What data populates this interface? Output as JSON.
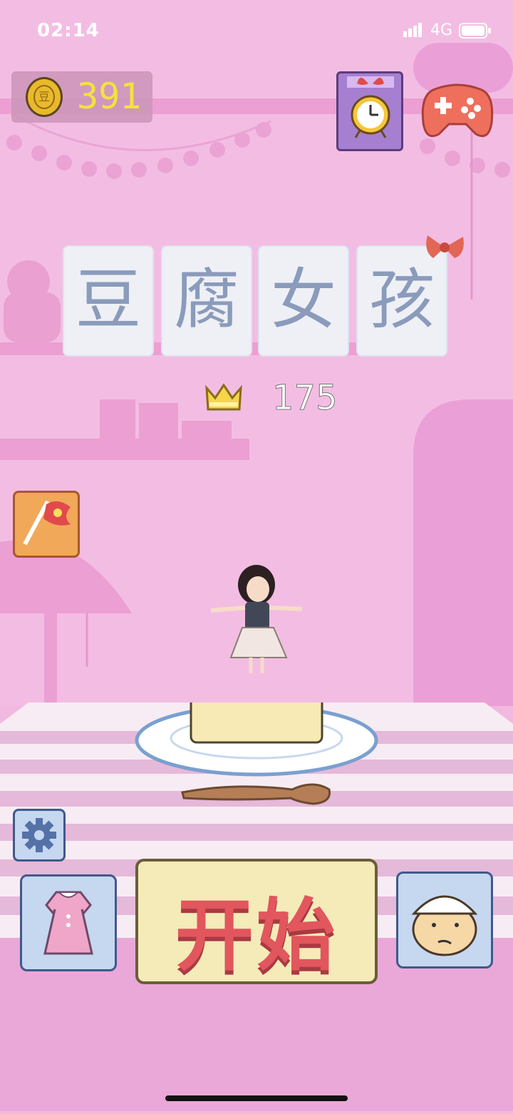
{
  "status_bar": {
    "time": "02:14",
    "network": "4G"
  },
  "currency": {
    "coin_symbol": "豆",
    "coins": "391"
  },
  "title": {
    "characters": [
      "豆",
      "腐",
      "女",
      "孩"
    ]
  },
  "best_score": {
    "value": "175",
    "icon": "crown-icon"
  },
  "buttons": {
    "start_label": "开始",
    "clock_icon": "alarm-clock-icon",
    "game_icon": "gamepad-icon",
    "flag_icon": "flag-icon",
    "settings_icon": "gear-icon",
    "dress_icon": "dress-icon",
    "chef_icon": "chef-face-icon"
  },
  "colors": {
    "background": "#f3bde3",
    "start_text": "#e2565d",
    "coin_text": "#f4e23c",
    "title_text": "#8a9bbb"
  }
}
